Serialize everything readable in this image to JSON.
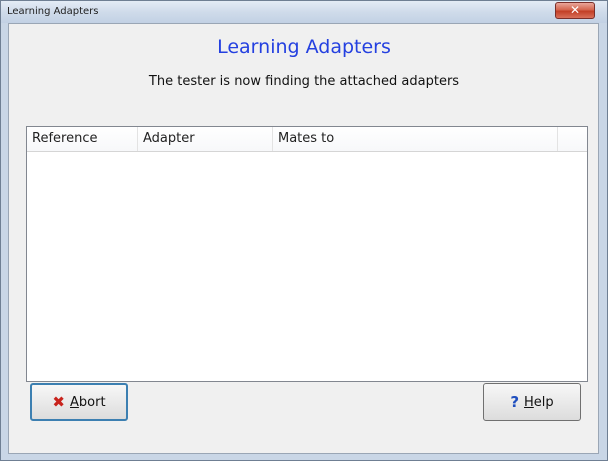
{
  "window": {
    "title": "Learning Adapters"
  },
  "dialog": {
    "heading": "Learning Adapters",
    "subheading": "The tester is now finding the attached adapters"
  },
  "adapter_list": {
    "columns": [
      "Reference",
      "Adapter",
      "Mates to",
      ""
    ],
    "rows": []
  },
  "buttons": {
    "abort": {
      "mnemonic": "A",
      "rest": "bort",
      "icon": "x-icon"
    },
    "help": {
      "mnemonic": "H",
      "rest": "elp",
      "icon": "question-icon"
    }
  },
  "colors": {
    "heading": "#2440e0",
    "abort_icon": "#c8231c",
    "help_icon": "#1f4fbf",
    "close_button": "#c23f26"
  }
}
